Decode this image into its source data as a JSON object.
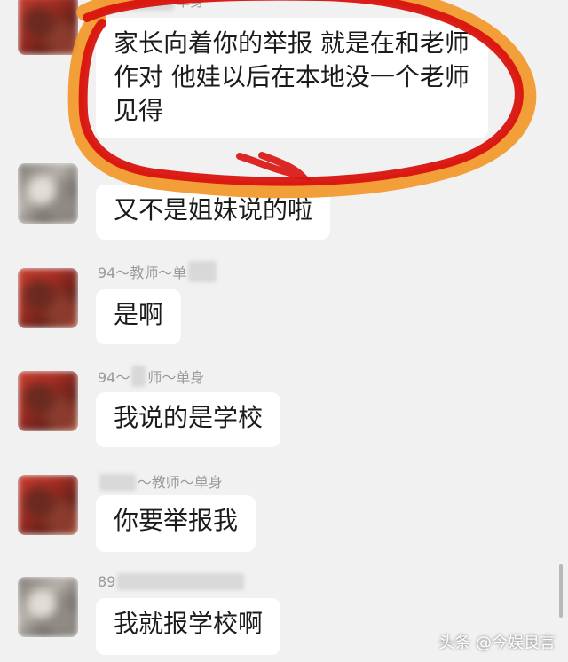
{
  "accent": {
    "highlight_red": "#d8120e",
    "highlight_orange": "#f19a2f"
  },
  "messages": [
    {
      "name_parts": [
        "",
        "单身"
      ],
      "avatar": "red",
      "text": "家长向着你的举报 就是在和老师\n作对 他娃以后在本地没一个老师\n见得"
    },
    {
      "name_parts": [],
      "avatar": "gray",
      "text": "又不是姐妹说的啦"
    },
    {
      "name_parts": [
        "94～教师～单",
        ""
      ],
      "avatar": "red",
      "text": "是啊"
    },
    {
      "name_parts": [
        "94～",
        "师～单身"
      ],
      "avatar": "red",
      "text": "我说的是学校"
    },
    {
      "name_parts": [
        "",
        "～教师～单身"
      ],
      "avatar": "red",
      "text": "你要举报我"
    },
    {
      "name_parts": [
        "89",
        ""
      ],
      "avatar": "gray",
      "text": "我就报学校啊"
    }
  ],
  "watermark": "头条 @今娱良言"
}
